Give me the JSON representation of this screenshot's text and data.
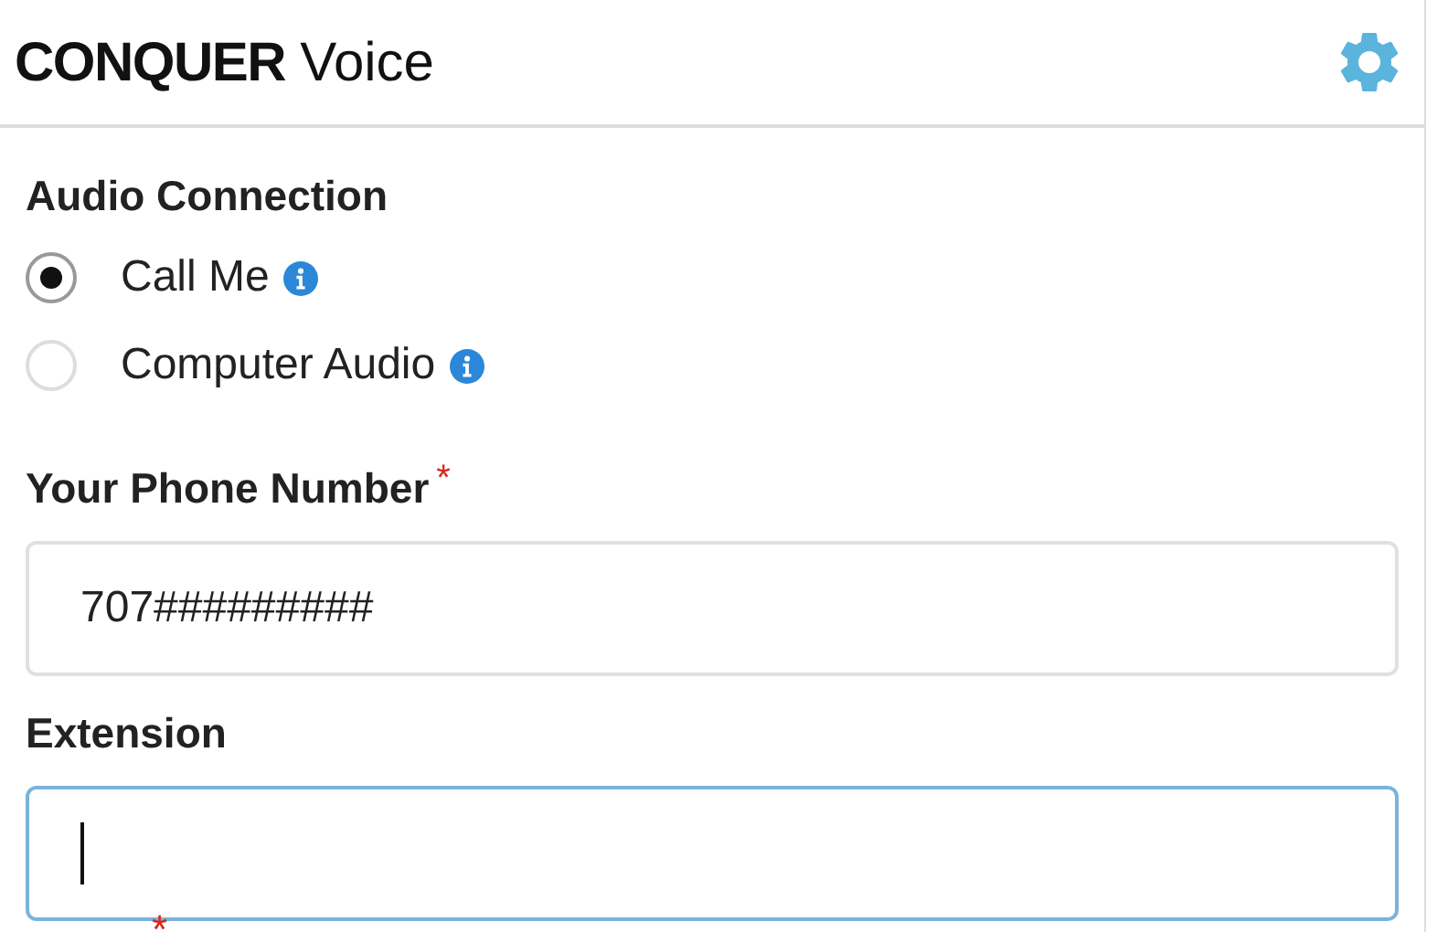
{
  "header": {
    "brand_bold": "CONQUER",
    "brand_regular": "Voice"
  },
  "audio_connection": {
    "label": "Audio Connection",
    "options": [
      {
        "label": "Call Me",
        "selected": true
      },
      {
        "label": "Computer Audio",
        "selected": false
      }
    ]
  },
  "fields": [
    {
      "label": "Your Phone Number",
      "required": true,
      "value": "707#########",
      "focused": false
    },
    {
      "label": "Extension",
      "required": false,
      "focused": true
    }
  ],
  "partial_required_mark": "*"
}
